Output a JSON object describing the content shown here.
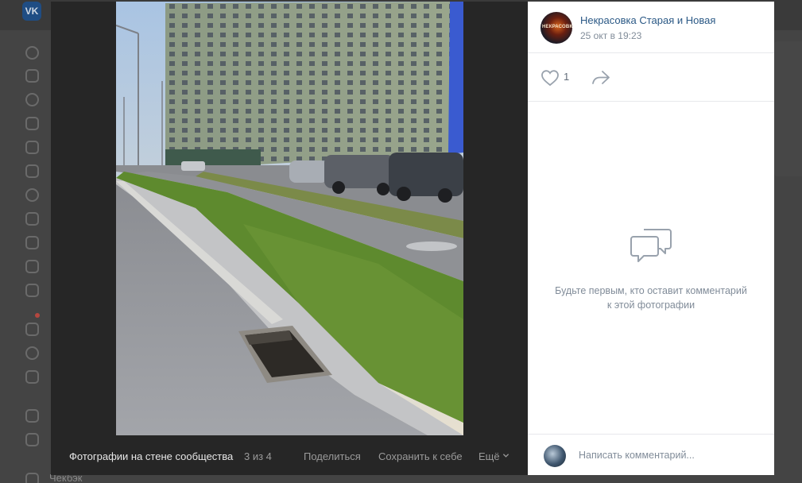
{
  "background": {
    "logo_text": "VK",
    "bottom_text": "Чекбэк"
  },
  "photo_viewer": {
    "album_title": "Фотографии на стене сообщества",
    "counter": "3 из 4",
    "share_label": "Поделиться",
    "save_label": "Сохранить к себе",
    "more_label": "Ещё"
  },
  "post": {
    "author_name": "Некрасовка Старая и Новая",
    "avatar_text": "НЕКРАСОВКА",
    "date": "25 окт в 19:23",
    "likes_count": "1"
  },
  "comments": {
    "empty_text": "Будьте первым, кто оставит комментарий к этой фотографии",
    "input_placeholder": "Написать комментарий..."
  },
  "colors": {
    "link": "#2a5885",
    "muted": "#818c99",
    "overlay": "#262626"
  }
}
